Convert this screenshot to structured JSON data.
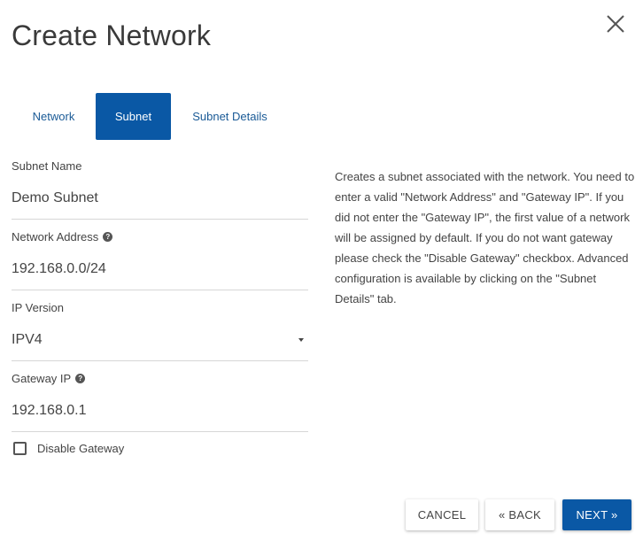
{
  "dialog": {
    "title": "Create Network"
  },
  "tabs": [
    {
      "label": "Network",
      "active": false
    },
    {
      "label": "Subnet",
      "active": true
    },
    {
      "label": "Subnet Details",
      "active": false
    }
  ],
  "form": {
    "subnet_name": {
      "label": "Subnet Name",
      "value": "Demo Subnet"
    },
    "network_address": {
      "label": "Network Address",
      "value": "192.168.0.0/24",
      "help_icon": "help-icon"
    },
    "ip_version": {
      "label": "IP Version",
      "value": "IPV4"
    },
    "gateway_ip": {
      "label": "Gateway IP",
      "value": "192.168.0.1",
      "help_icon": "help-icon"
    },
    "disable_gateway": {
      "label": "Disable Gateway",
      "checked": false
    }
  },
  "description": "Creates a subnet associated with the network. You need to enter a valid \"Network Address\" and \"Gateway IP\". If you did not enter the \"Gateway IP\", the first value of a network will be assigned by default. If you do not want gateway please check the \"Disable Gateway\" checkbox. Advanced configuration is available by clicking on the \"Subnet Details\" tab.",
  "buttons": {
    "cancel": "CANCEL",
    "back": "« BACK",
    "next": "NEXT »"
  },
  "colors": {
    "primary": "#0a58a5",
    "tab_text": "#1a5a96"
  },
  "icons": {
    "close": "close-icon",
    "help": "help-icon",
    "dropdown": "caret-down-icon"
  }
}
